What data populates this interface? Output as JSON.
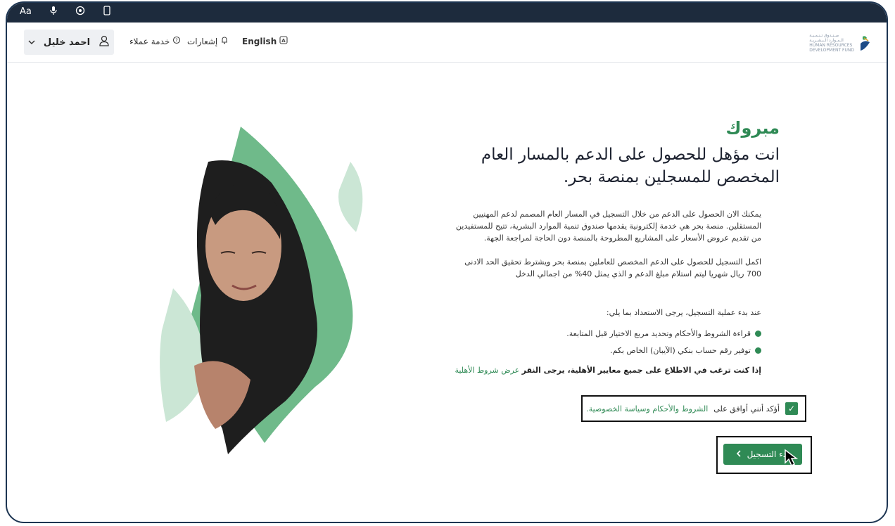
{
  "topbar": {
    "icons": [
      "text-size-icon",
      "microphone-icon",
      "eye-icon",
      "tablet-icon"
    ],
    "text_size_label": "Aa"
  },
  "header": {
    "user_name": "احمد خليل",
    "customer_service": "خدمة عملاء",
    "notifications": "إشعارات",
    "language": "English",
    "logo_lines": [
      "صـنـدوق تـنـمـيـة",
      "الـمـوارد الـبـشـريـة",
      "HUMAN RESOURCES",
      "DEVELOPMENT FUND"
    ]
  },
  "content": {
    "congrats": "مبروك",
    "headline": "انت مؤهل للحصول على الدعم بالمسار العام المخصص للمسجلين بمنصة بحر.",
    "para1": "يمكنك الان الحصول على الدعم من خلال التسجيل في المسار العام المصمم لدعم المهنيين المستقلين. منصة بحر هي خدمة إلكترونية يقدمها صندوق تنمية الموارد البشرية، تتيح للمستفيدين من تقديم عروض الأسعار على المشاريع المطروحة بالمنصة دون الحاجة لمراجعة الجهة.",
    "para2": "اكمل التسجيل للحصول على الدعم المخصص للعاملين بمنصة بحر ويشترط تحقيق الحد الادنى 700 ريال شهريا ليتم استلام مبلغ الدعم و الذي يمثل 40% من اجمالي الدخل",
    "prep_title": "عند بدء عملية التسجيل، يرجى الاستعداد بما يلي:",
    "bullets": [
      "قراءة الشروط والأحكام وتحديد مربع الاختيار قبل المتابعة.",
      "توفير رقم حساب بنكي (الآيبان) الخاص بكم."
    ],
    "eligibility_text": "إذا كنت ترغب في الاطلاع على جميع معايير الأهلية، يرجى النقر",
    "eligibility_link": "عرض شروط الأهلية",
    "consent_text": "أؤكد أنني أوافق على",
    "consent_link": "الشروط والأحكام وسياسة الخصوصية.",
    "start_button": "بدء التسجيل"
  },
  "colors": {
    "accent": "#2f8a55",
    "frame": "#1d3552",
    "topstrip": "#1d2b3d"
  }
}
